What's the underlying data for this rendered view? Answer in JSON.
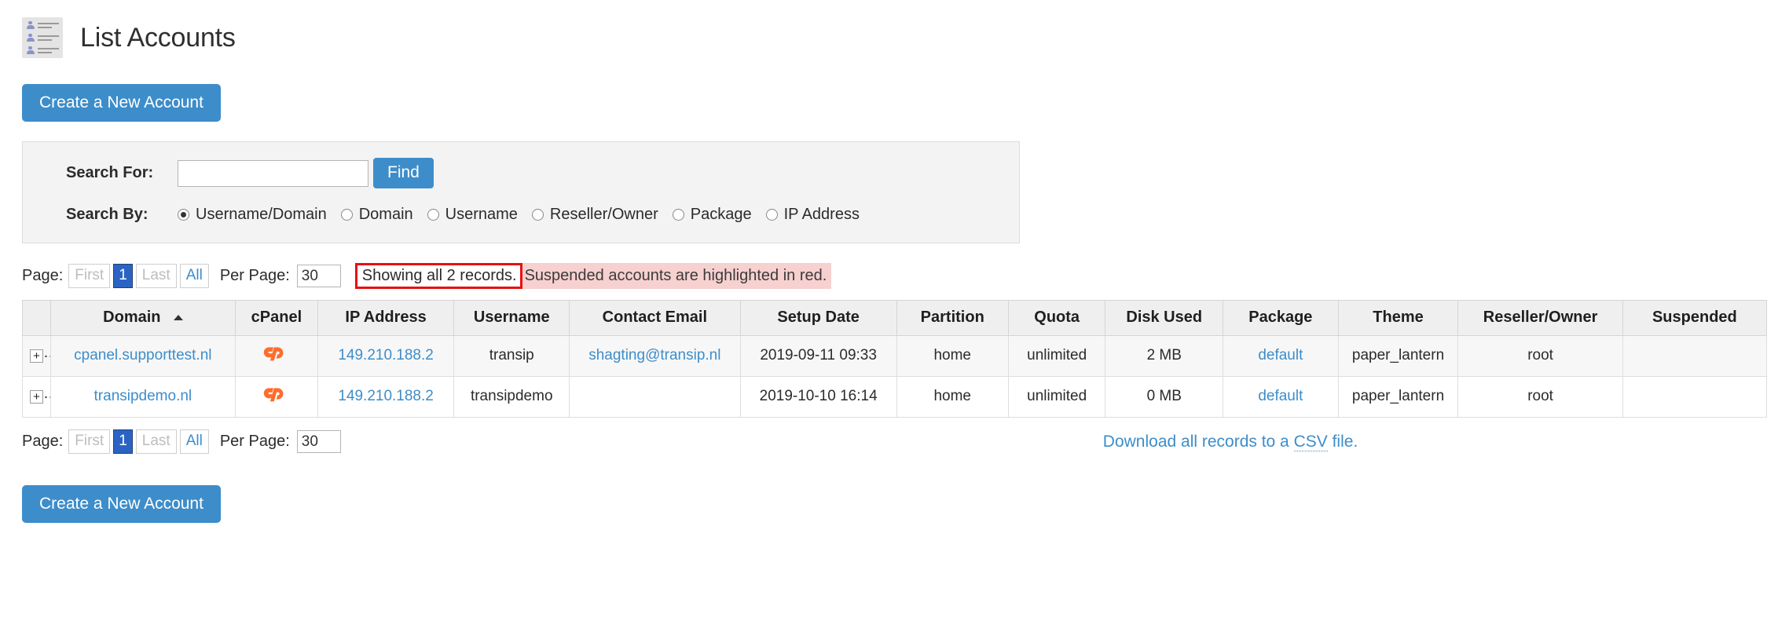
{
  "header": {
    "icon": "accounts-list-icon",
    "title": "List Accounts"
  },
  "actions": {
    "create_account_top": "Create a New Account",
    "create_account_bottom": "Create a New Account"
  },
  "search": {
    "for_label": "Search For:",
    "input_value": "",
    "input_placeholder": "",
    "find_label": "Find",
    "by_label": "Search By:",
    "options": [
      {
        "label": "Username/Domain",
        "checked": true
      },
      {
        "label": "Domain",
        "checked": false
      },
      {
        "label": "Username",
        "checked": false
      },
      {
        "label": "Reseller/Owner",
        "checked": false
      },
      {
        "label": "Package",
        "checked": false
      },
      {
        "label": "IP Address",
        "checked": false
      }
    ]
  },
  "pager_top": {
    "page_label": "Page:",
    "first": "First",
    "current": "1",
    "last": "Last",
    "all": "All",
    "per_page_label": "Per Page:",
    "per_page_value": "30",
    "records_text": "Showing all 2 records.",
    "suspended_note": "Suspended accounts are highlighted in red.",
    "records_border_color": "#e81010",
    "suspended_bg_color": "#f7d0d0"
  },
  "pager_bottom": {
    "page_label": "Page:",
    "first": "First",
    "current": "1",
    "last": "Last",
    "all": "All",
    "per_page_label": "Per Page:",
    "per_page_value": "30"
  },
  "csv": {
    "text_before": "Download all records to a ",
    "abbr": "CSV",
    "text_after": " file."
  },
  "table": {
    "sort_column": "Domain",
    "sort_direction": "asc",
    "columns": [
      "Domain",
      "cPanel",
      "IP Address",
      "Username",
      "Contact Email",
      "Setup Date",
      "Partition",
      "Quota",
      "Disk Used",
      "Package",
      "Theme",
      "Reseller/Owner",
      "Suspended"
    ],
    "expand_glyph": "+",
    "rows": [
      {
        "domain": "cpanel.supporttest.nl",
        "cpanel": "cpanel-logo-icon",
        "ip_address": "149.210.188.2",
        "username": "transip",
        "contact_email": "shagting@transip.nl",
        "setup_date": "2019-09-11 09:33",
        "partition": "home",
        "quota": "unlimited",
        "disk_used": "2 MB",
        "package": "default",
        "theme": "paper_lantern",
        "reseller_owner": "root",
        "suspended": ""
      },
      {
        "domain": "transipdemo.nl",
        "cpanel": "cpanel-logo-icon",
        "ip_address": "149.210.188.2",
        "username": "transipdemo",
        "contact_email": "",
        "setup_date": "2019-10-10 16:14",
        "partition": "home",
        "quota": "unlimited",
        "disk_used": "0 MB",
        "package": "default",
        "theme": "paper_lantern",
        "reseller_owner": "root",
        "suspended": ""
      }
    ]
  },
  "colors": {
    "accent": "#3d8dca",
    "link": "#3d8dca",
    "cpanel_orange": "#ff6c2c",
    "active_page": "#2b63c4"
  }
}
